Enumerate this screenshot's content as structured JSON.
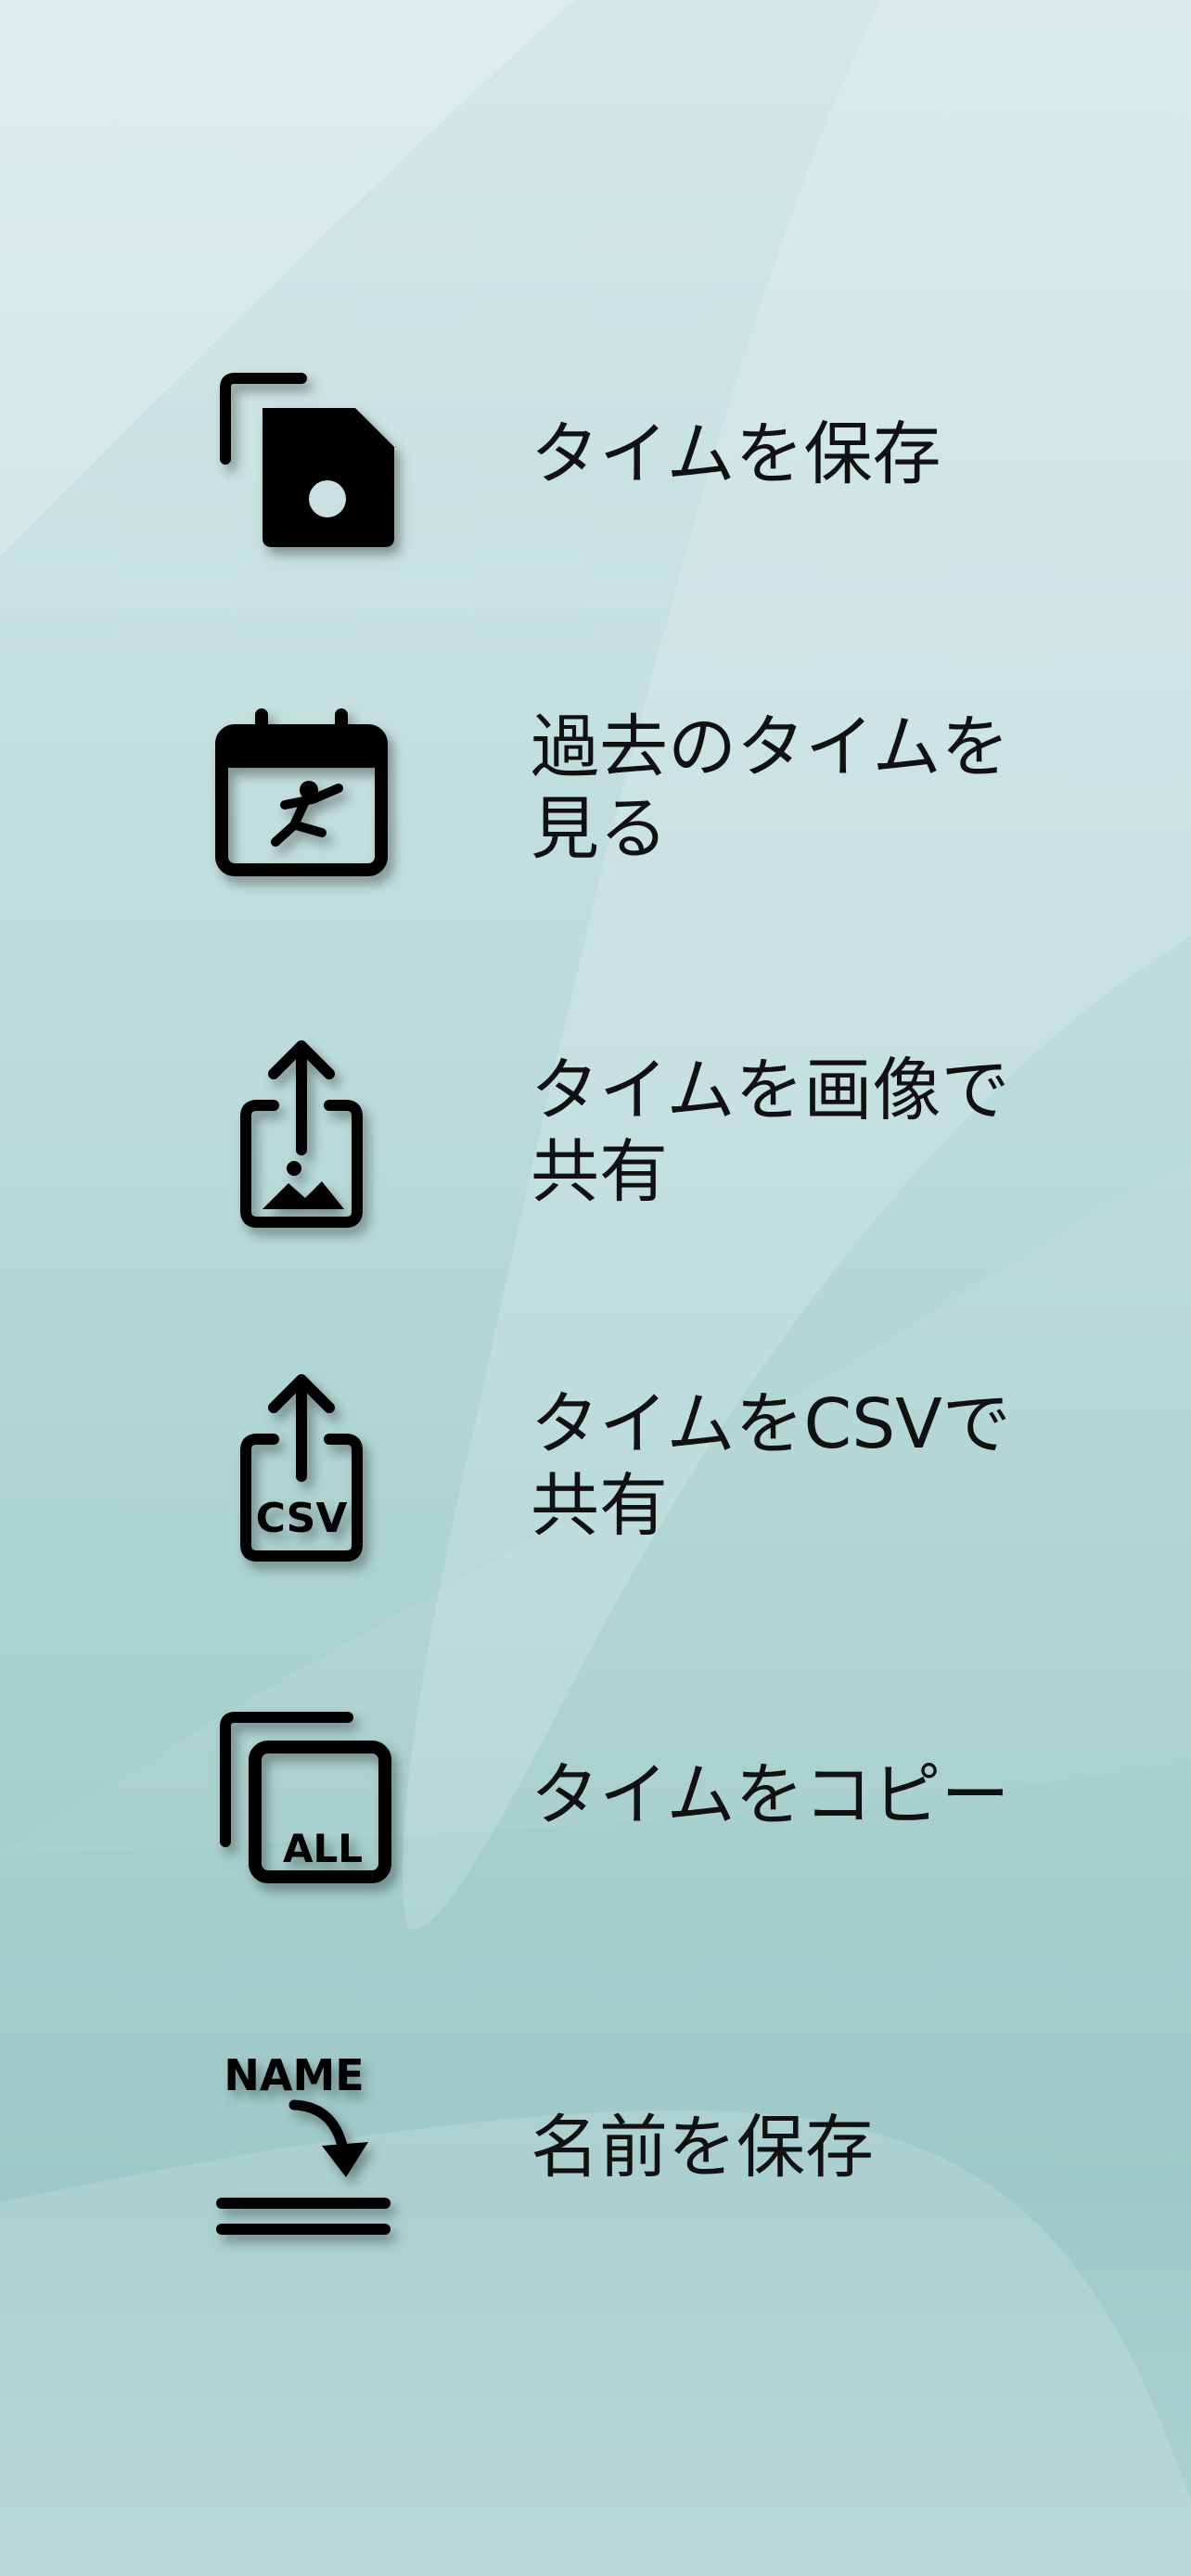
{
  "colors": {
    "icon": "#000000",
    "text": "#111111",
    "background": "#b8dad9"
  },
  "menu": {
    "items": [
      {
        "key": "save-time",
        "icon": "save-icon",
        "label": "タイムを保存"
      },
      {
        "key": "view-past",
        "icon": "calendar-icon",
        "label": "過去のタイムを見る"
      },
      {
        "key": "share-image",
        "icon": "share-image-icon",
        "label": "タイムを画像で共有"
      },
      {
        "key": "share-csv",
        "icon": "share-csv-icon",
        "label": "タイムをCSVで共有",
        "icon_text": "CSV"
      },
      {
        "key": "copy-time",
        "icon": "copy-all-icon",
        "label": "タイムをコピー",
        "icon_text": "ALL"
      },
      {
        "key": "save-name",
        "icon": "save-name-icon",
        "label": "名前を保存",
        "icon_text": "NAME"
      }
    ]
  }
}
